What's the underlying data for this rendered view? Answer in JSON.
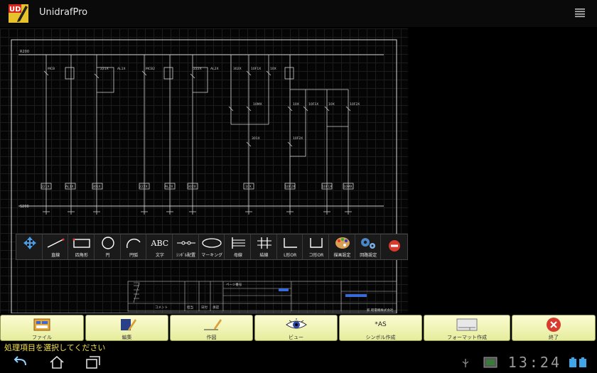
{
  "app": {
    "title": "UnidrafPro",
    "logo_text": "UD"
  },
  "drawing": {
    "bus_top_label": "R200",
    "bus_bottom_label": "S200",
    "top_labels": [
      "MCB",
      "221X",
      "AL1X",
      "MCB2",
      "222X",
      "AL2X",
      "302X",
      "10F1X",
      "10X"
    ],
    "bottom_labels": [
      "221X",
      "AL1X",
      "301X",
      "222X",
      "AL2X",
      "302X",
      "10X",
      "10F2X",
      "10F1X",
      "10MX"
    ],
    "mid_labels": [
      "10MX",
      "10X",
      "10F1X",
      "10X",
      "10F2X",
      "301X",
      "10F2X"
    ],
    "title_block": {
      "comment_label": "コメント",
      "col_labels": [
        "担当",
        "日付",
        "承認"
      ],
      "page_label": "ページ番号",
      "company": "新 昭電機株式会社"
    }
  },
  "palette": {
    "items": [
      {
        "label": "",
        "icon": "move-icon"
      },
      {
        "label": "直線",
        "icon": "line-icon"
      },
      {
        "label": "四角形",
        "icon": "rectangle-icon"
      },
      {
        "label": "円",
        "icon": "circle-icon"
      },
      {
        "label": "円弧",
        "icon": "arc-icon"
      },
      {
        "label": "文字",
        "icon": "text-icon",
        "glyph": "ABC"
      },
      {
        "label": "ｼﾝﾎﾞﾙ配置",
        "icon": "symbol-icon"
      },
      {
        "label": "マーキング",
        "icon": "ellipse-icon"
      },
      {
        "label": "母線",
        "icon": "busbar-icon"
      },
      {
        "label": "結線",
        "icon": "wiring-icon"
      },
      {
        "label": "L形OR",
        "icon": "l-shape-icon"
      },
      {
        "label": "コ形OR",
        "icon": "u-shape-icon"
      },
      {
        "label": "描画設定",
        "icon": "palette-icon"
      },
      {
        "label": "回路設定",
        "icon": "gears-icon"
      },
      {
        "label": "",
        "icon": "stop-icon"
      }
    ]
  },
  "toolbar": {
    "file": "ファイル",
    "edit": "編集",
    "draw": "作図",
    "view": "ビュー",
    "symbol": "シンボル作成",
    "symbol_glyph": "*AS",
    "format": "フォーマット作成",
    "exit": "終了"
  },
  "status": {
    "message": "処理項目を選択してください"
  },
  "system": {
    "clock": "13:24"
  },
  "colors": {
    "toolbar_bg": "#eef2b0",
    "status_text": "#f2e04a",
    "accent_red": "#d83b2e"
  }
}
